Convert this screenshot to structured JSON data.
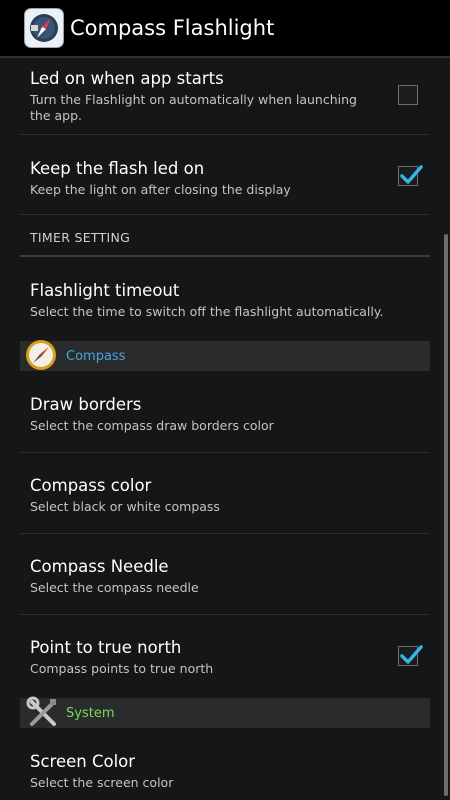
{
  "app": {
    "title": "Compass Flashlight"
  },
  "prefs": {
    "led_on_start": {
      "title": "Led on when app starts",
      "summary": "Turn the Flashlight on automatically when launching the app.",
      "checked": false
    },
    "keep_flash": {
      "title": "Keep the flash led on",
      "summary": "Keep the light on after closing the display",
      "checked": true
    },
    "timer_header": "TIMER SETTING",
    "timeout": {
      "title": "Flashlight timeout",
      "summary": "Select the time to switch off the flashlight automatically."
    },
    "compass_category": {
      "label": "Compass",
      "icon": "compass-icon",
      "color": "#4aa3df"
    },
    "draw_borders": {
      "title": "Draw borders",
      "summary": "Select the compass draw borders color"
    },
    "compass_color": {
      "title": "Compass color",
      "summary": "Select black or white compass"
    },
    "compass_needle": {
      "title": "Compass Needle",
      "summary": "Select the compass needle"
    },
    "true_north": {
      "title": "Point to true north",
      "summary": "Compass points to true north",
      "checked": true
    },
    "system_category": {
      "label": "System",
      "icon": "wrench-screwdriver-icon",
      "color": "#7ed957"
    },
    "screen_color": {
      "title": "Screen Color",
      "summary": "Select the screen color"
    }
  },
  "colors": {
    "check_accent": "#33b5e5",
    "background": "#151617"
  }
}
